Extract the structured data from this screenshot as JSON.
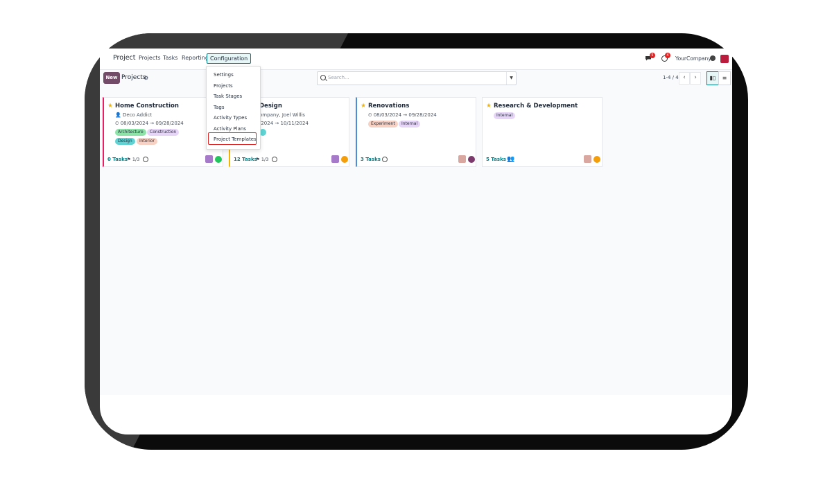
{
  "navbar": {
    "app_name": "Project",
    "menus": [
      "Projects",
      "Tasks",
      "Reporting"
    ],
    "active_menu": "Configuration",
    "chat_badge": "5",
    "activity_badge": "4",
    "company": "YourCompany"
  },
  "control_panel": {
    "new_label": "New",
    "breadcrumb": "Projects",
    "search_placeholder": "Search...",
    "pager": "1-4 / 4"
  },
  "dropdown": {
    "items": [
      "Settings",
      "Projects",
      "Task Stages",
      "Tags",
      "Activity Types",
      "Activity Plans",
      "Project Templates"
    ],
    "highlighted": "Project Templates"
  },
  "cards": [
    {
      "title": "Home Construction",
      "customer": "Deco Addict",
      "start": "08/03/2024",
      "end": "09/28/2024",
      "tags": [
        "Architecture",
        "Construction",
        "Design",
        "Interior"
      ],
      "tasks": "0 Tasks",
      "milestones": "1/3",
      "color": "#e91e63"
    },
    {
      "title": "Design",
      "customer": "ompany, Joel Willis",
      "start": "/2024",
      "end": "10/11/2024",
      "tasks": "12 Tasks",
      "milestones": "1/3",
      "color": "#f4b400"
    },
    {
      "title": "Renovations",
      "start": "08/03/2024",
      "end": "09/28/2024",
      "tags": [
        "Experiment",
        "Internal"
      ],
      "tasks": "3 Tasks",
      "color": "#4a8fd6"
    },
    {
      "title": "Research & Development",
      "tags": [
        "Internal"
      ],
      "tasks": "5 Tasks"
    }
  ],
  "colors": {
    "primary": "#714b67",
    "accent": "#017e84",
    "status_green": "#22c55e",
    "status_orange": "#f59e0b",
    "status_purple": "#7b3a6b"
  }
}
